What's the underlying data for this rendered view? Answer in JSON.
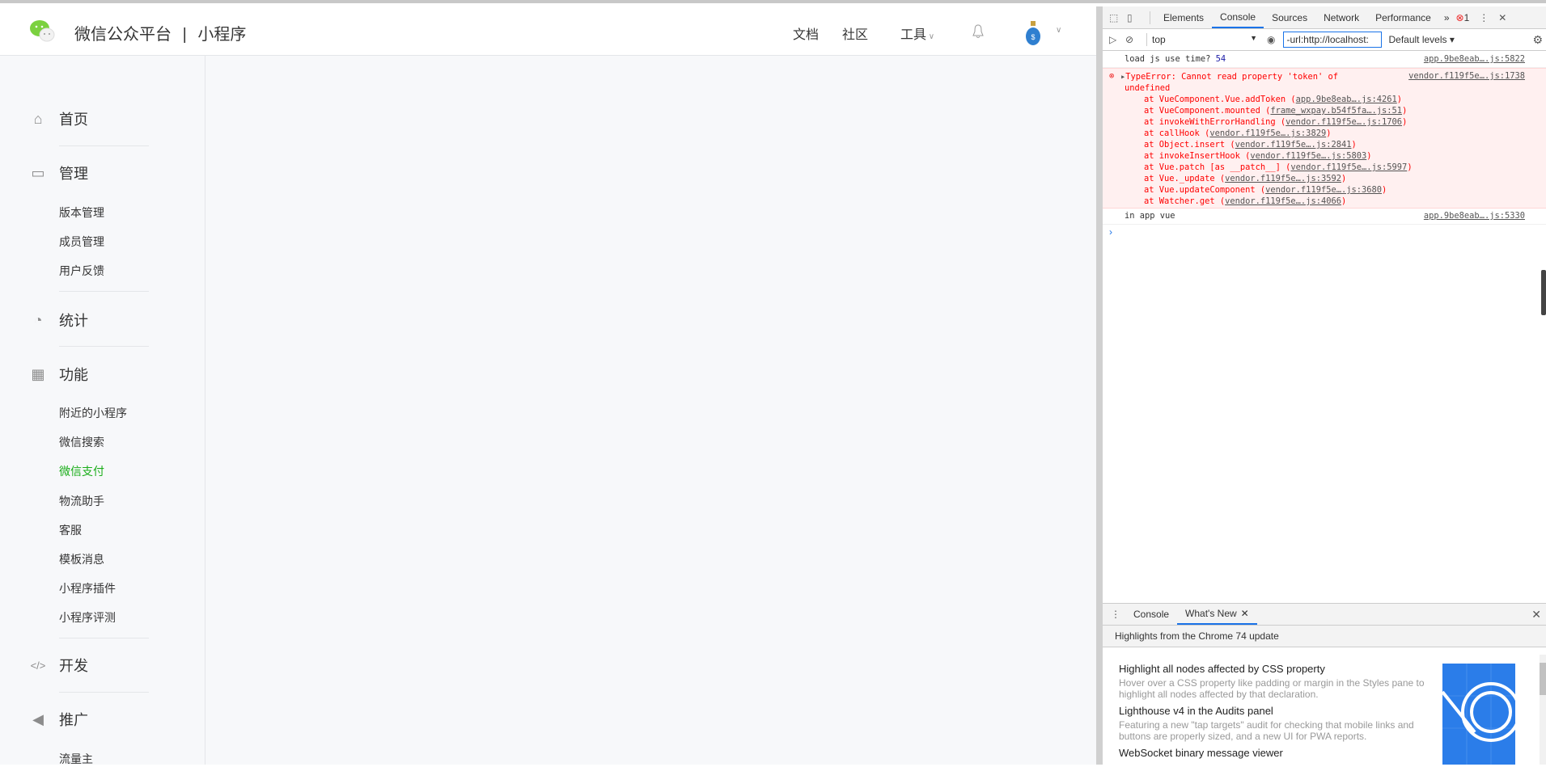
{
  "header": {
    "brand": "微信公众平台",
    "separator": "|",
    "product": "小程序",
    "nav": [
      "文档",
      "社区",
      "工具"
    ]
  },
  "sidebar": {
    "sections": [
      {
        "label": "首页",
        "icon": "home-icon",
        "items": []
      },
      {
        "label": "管理",
        "icon": "inbox-icon",
        "items": [
          "版本管理",
          "成员管理",
          "用户反馈"
        ]
      },
      {
        "label": "统计",
        "icon": "pie-chart-icon",
        "items": []
      },
      {
        "label": "功能",
        "icon": "grid-icon",
        "items": [
          "附近的小程序",
          "微信搜索",
          "微信支付",
          "物流助手",
          "客服",
          "模板消息",
          "小程序插件",
          "小程序评测"
        ]
      },
      {
        "label": "开发",
        "icon": "code-icon",
        "items": []
      },
      {
        "label": "推广",
        "icon": "megaphone-icon",
        "items": [
          "流量主"
        ]
      }
    ],
    "active_item": "微信支付"
  },
  "devtools": {
    "tabs": [
      "Elements",
      "Console",
      "Sources",
      "Network",
      "Performance"
    ],
    "active_tab": "Console",
    "error_count": "1",
    "context": "top",
    "filter": "-url:http://localhost:",
    "levels": "Default levels ▾",
    "log1": {
      "text": "load js use time?",
      "value": "54",
      "src": "app.9be8eab….js:5822"
    },
    "error": {
      "message": "TypeError: Cannot read property 'token' of",
      "message2": "undefined",
      "src": "vendor.f119f5e….js:1738",
      "stack": [
        [
          "at VueComponent.Vue.addToken (",
          "app.9be8eab….js:4261",
          ")"
        ],
        [
          "at VueComponent.mounted (",
          "frame_wxpay.b54f5fa….js:51",
          ")"
        ],
        [
          "at invokeWithErrorHandling (",
          "vendor.f119f5e….js:1706",
          ")"
        ],
        [
          "at callHook (",
          "vendor.f119f5e….js:3829",
          ")"
        ],
        [
          "at Object.insert (",
          "vendor.f119f5e….js:2841",
          ")"
        ],
        [
          "at invokeInsertHook (",
          "vendor.f119f5e….js:5803",
          ")"
        ],
        [
          "at Vue.patch [as __patch__] (",
          "vendor.f119f5e….js:5997",
          ")"
        ],
        [
          "at Vue._update (",
          "vendor.f119f5e….js:3592",
          ")"
        ],
        [
          "at Vue.updateComponent (",
          "vendor.f119f5e….js:3680",
          ")"
        ],
        [
          "at Watcher.get (",
          "vendor.f119f5e….js:4066",
          ")"
        ]
      ]
    },
    "log2": {
      "text": "in app vue",
      "src": "app.9be8eab….js:5330"
    },
    "drawer": {
      "tabs": [
        "Console",
        "What's New"
      ],
      "active_tab": "What's New",
      "banner": "Highlights from the Chrome 74 update",
      "items": [
        {
          "title": "Highlight all nodes affected by CSS property",
          "desc": "Hover over a CSS property like padding or margin in the Styles pane to highlight all nodes affected by that declaration."
        },
        {
          "title": "Lighthouse v4 in the Audits panel",
          "desc": "Featuring a new \"tap targets\" audit for checking that mobile links and buttons are properly sized, and a new UI for PWA reports."
        },
        {
          "title": "WebSocket binary message viewer",
          "desc": ""
        }
      ]
    }
  },
  "colors": {
    "accent": "#1aad19",
    "error": "#ff0000",
    "devtools_blue": "#1a73e8"
  }
}
